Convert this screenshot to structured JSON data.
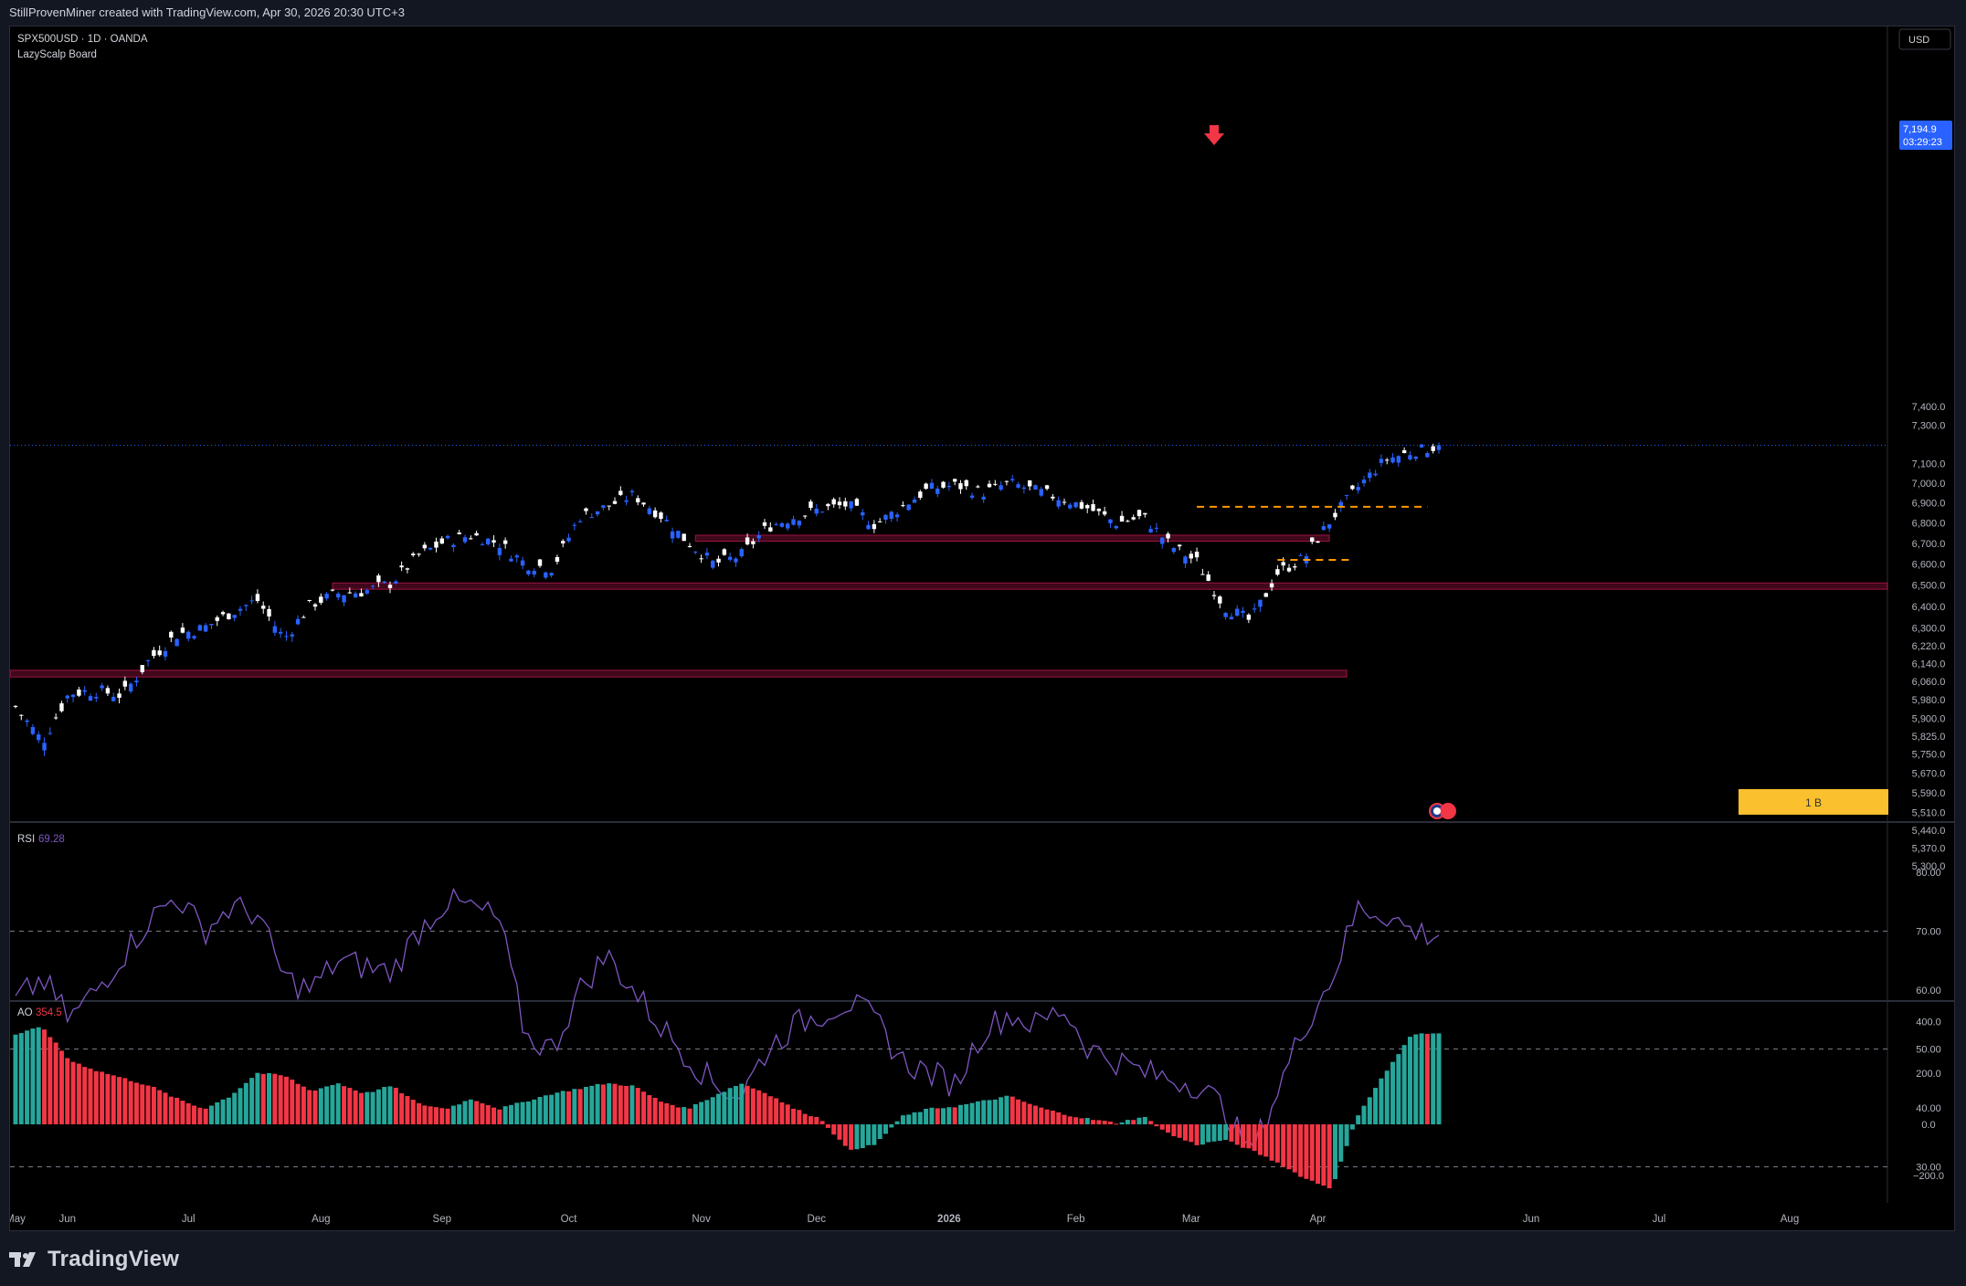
{
  "header": {
    "attribution": "StillProvenMiner created with TradingView.com, Apr 30, 2026 20:30 UTC+3"
  },
  "chart_info": {
    "symbol": "SPX500USD · 1D · OANDA",
    "indicator": "LazyScalp Board"
  },
  "currency": "USD",
  "last_price": {
    "value": "7,194.9",
    "countdown": "03:29:23",
    "color": "#2962ff"
  },
  "volume_badge": "1 B",
  "footer": {
    "brand": "TradingView"
  },
  "colors": {
    "up": "#2962ff",
    "down": "#ffffff",
    "zone": "#e91e63",
    "dashed": "#ff9800",
    "rsi": "#7e57c2",
    "ao_up": "#26a69a",
    "ao_down": "#f23645",
    "badge": "#fbc02d",
    "arrow": "#f23645"
  },
  "chart_data": [
    {
      "type": "candlestick",
      "name": "SPX500USD",
      "scale": "log",
      "price_ticks": [
        "7,400.0",
        "7,300.0",
        "7,100.0",
        "7,000.0",
        "6,900.0",
        "6,800.0",
        "6,700.0",
        "6,600.0",
        "6,500.0",
        "6,400.0",
        "6,300.0",
        "6,220.0",
        "6,140.0",
        "6,060.0",
        "5,980.0",
        "5,900.0",
        "5,825.0",
        "5,750.0",
        "5,670.0",
        "5,590.0",
        "5,510.0",
        "5,440.0",
        "5,370.0",
        "5,300.0"
      ],
      "time_ticks": [
        "Jun",
        "Jul",
        "Aug",
        "Sep",
        "Oct",
        "Nov",
        "Dec",
        "2026",
        "Feb",
        "Mar",
        "Apr",
        "May",
        "Jun",
        "Jul",
        "Aug"
      ],
      "anchors": [
        [
          5945,
          5950
        ],
        [
          5780,
          5800
        ],
        [
          6000,
          6010
        ],
        [
          6030,
          6020
        ],
        [
          6000,
          6000
        ],
        [
          6150,
          6160
        ],
        [
          6260,
          6270
        ],
        [
          6290,
          6300
        ],
        [
          6350,
          6370
        ],
        [
          6410,
          6430
        ],
        [
          6280,
          6250
        ],
        [
          6400,
          6410
        ],
        [
          6450,
          6460
        ],
        [
          6460,
          6470
        ],
        [
          6500,
          6510
        ],
        [
          6620,
          6640
        ],
        [
          6700,
          6710
        ],
        [
          6720,
          6740
        ],
        [
          6700,
          6700
        ],
        [
          6620,
          6600
        ],
        [
          6550,
          6580
        ],
        [
          6820,
          6830
        ],
        [
          6870,
          6880
        ],
        [
          6930,
          6940
        ],
        [
          6820,
          6840
        ],
        [
          6720,
          6710
        ],
        [
          6580,
          6600
        ],
        [
          6630,
          6640
        ],
        [
          6790,
          6780
        ],
        [
          6820,
          6830
        ],
        [
          6860,
          6870
        ],
        [
          6880,
          6890
        ],
        [
          6780,
          6790
        ],
        [
          6870,
          6880
        ],
        [
          6960,
          6970
        ],
        [
          6980,
          6990
        ],
        [
          6960,
          6950
        ],
        [
          6990,
          7000
        ],
        [
          6970,
          6960
        ],
        [
          6930,
          6920
        ],
        [
          6880,
          6870
        ],
        [
          6790,
          6800
        ],
        [
          6820,
          6830
        ],
        [
          6700,
          6690
        ],
        [
          6620,
          6610
        ],
        [
          6420,
          6400
        ],
        [
          6320,
          6330
        ],
        [
          6540,
          6560
        ],
        [
          6620,
          6630
        ],
        [
          6800,
          6820
        ],
        [
          6960,
          6980
        ],
        [
          7100,
          7120
        ],
        [
          7150,
          7160
        ],
        [
          7180,
          7190
        ]
      ],
      "zones": [
        [
          6710,
          6740,
          "Oct 31",
          "Apr 3"
        ],
        [
          6480,
          6510,
          "Aug 5",
          "end"
        ],
        [
          6080,
          6110,
          "start",
          "Apr 8"
        ]
      ],
      "dashed_levels": [
        [
          6880,
          "Mar 3",
          "Apr 28"
        ],
        [
          6620,
          "Mar 23",
          "Apr 9"
        ]
      ],
      "last_price": 7194.9
    },
    {
      "type": "line",
      "name": "RSI",
      "value_label": "69.28",
      "y_ticks": [
        "80.00",
        "70.00",
        "60.00",
        "50.00",
        "40.00",
        "30.00"
      ],
      "levels": [
        70,
        50,
        30
      ],
      "anchors": [
        58,
        62,
        55,
        60,
        66,
        72,
        76,
        70,
        74,
        73,
        62,
        60,
        65,
        64,
        63,
        70,
        75,
        74,
        72,
        52,
        50,
        60,
        66,
        60,
        54,
        49,
        44,
        42,
        50,
        54,
        56,
        58,
        55,
        48,
        46,
        44,
        53,
        56,
        54,
        57,
        50,
        48,
        46,
        45,
        44,
        40,
        32,
        43,
        54,
        62,
        74,
        73,
        70,
        69.28
      ]
    },
    {
      "type": "histogram",
      "name": "AO",
      "value_label": "354.5",
      "y_ticks": [
        "400.0",
        "200.0",
        "0.0",
        "−200.0"
      ],
      "anchors": [
        350,
        380,
        250,
        210,
        180,
        150,
        100,
        60,
        110,
        200,
        190,
        130,
        160,
        120,
        150,
        80,
        60,
        100,
        60,
        90,
        120,
        140,
        160,
        150,
        90,
        60,
        110,
        160,
        120,
        60,
        20,
        -100,
        -80,
        30,
        60,
        70,
        90,
        110,
        70,
        40,
        20,
        5,
        30,
        -40,
        -80,
        -60,
        -100,
        -150,
        -210,
        -250,
        40,
        200,
        350,
        354.5
      ]
    }
  ]
}
